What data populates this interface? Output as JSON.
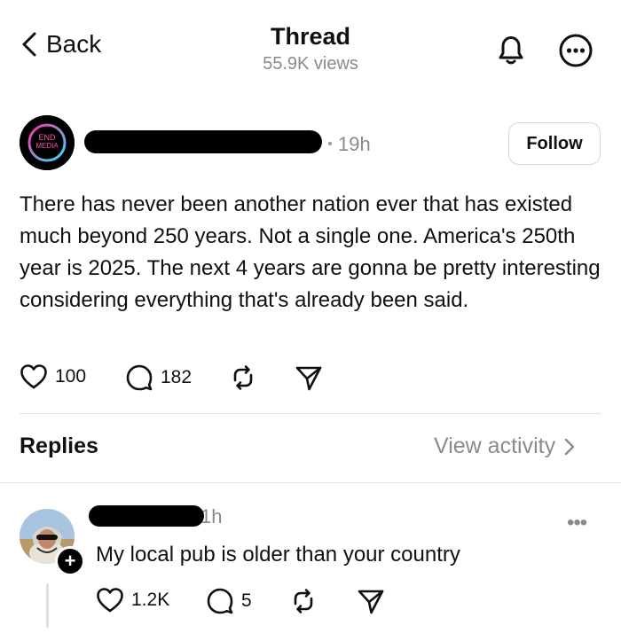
{
  "header": {
    "back_label": "Back",
    "title": "Thread",
    "views": "55.9K views"
  },
  "post": {
    "avatar_logo_text_1": "END",
    "avatar_logo_text_2": "MEDIA",
    "time": "19h",
    "follow_label": "Follow",
    "body": "There has never been another nation ever that has existed much beyond 250 years. Not a single one. America's 250th year is 2025. The next 4 years are gonna be pretty interesting considering everything that's already been said.",
    "likes": "100",
    "comments": "182"
  },
  "replies_section": {
    "title": "Replies",
    "view_activity": "View activity"
  },
  "reply": {
    "time": "1h",
    "more": "•••",
    "body": "My local pub is older than your country",
    "likes": "1.2K",
    "comments": "5"
  },
  "colors": {
    "text": "#101010",
    "muted": "#8a8a8a",
    "divider": "#e3e3e3",
    "logo_ring_start": "#ff2da0",
    "logo_ring_end": "#2de0ff"
  },
  "icons": [
    "chevron-left-icon",
    "bell-icon",
    "more-circle-icon",
    "heart-icon",
    "comment-icon",
    "repost-icon",
    "send-icon",
    "chevron-right-icon",
    "plus-icon"
  ]
}
